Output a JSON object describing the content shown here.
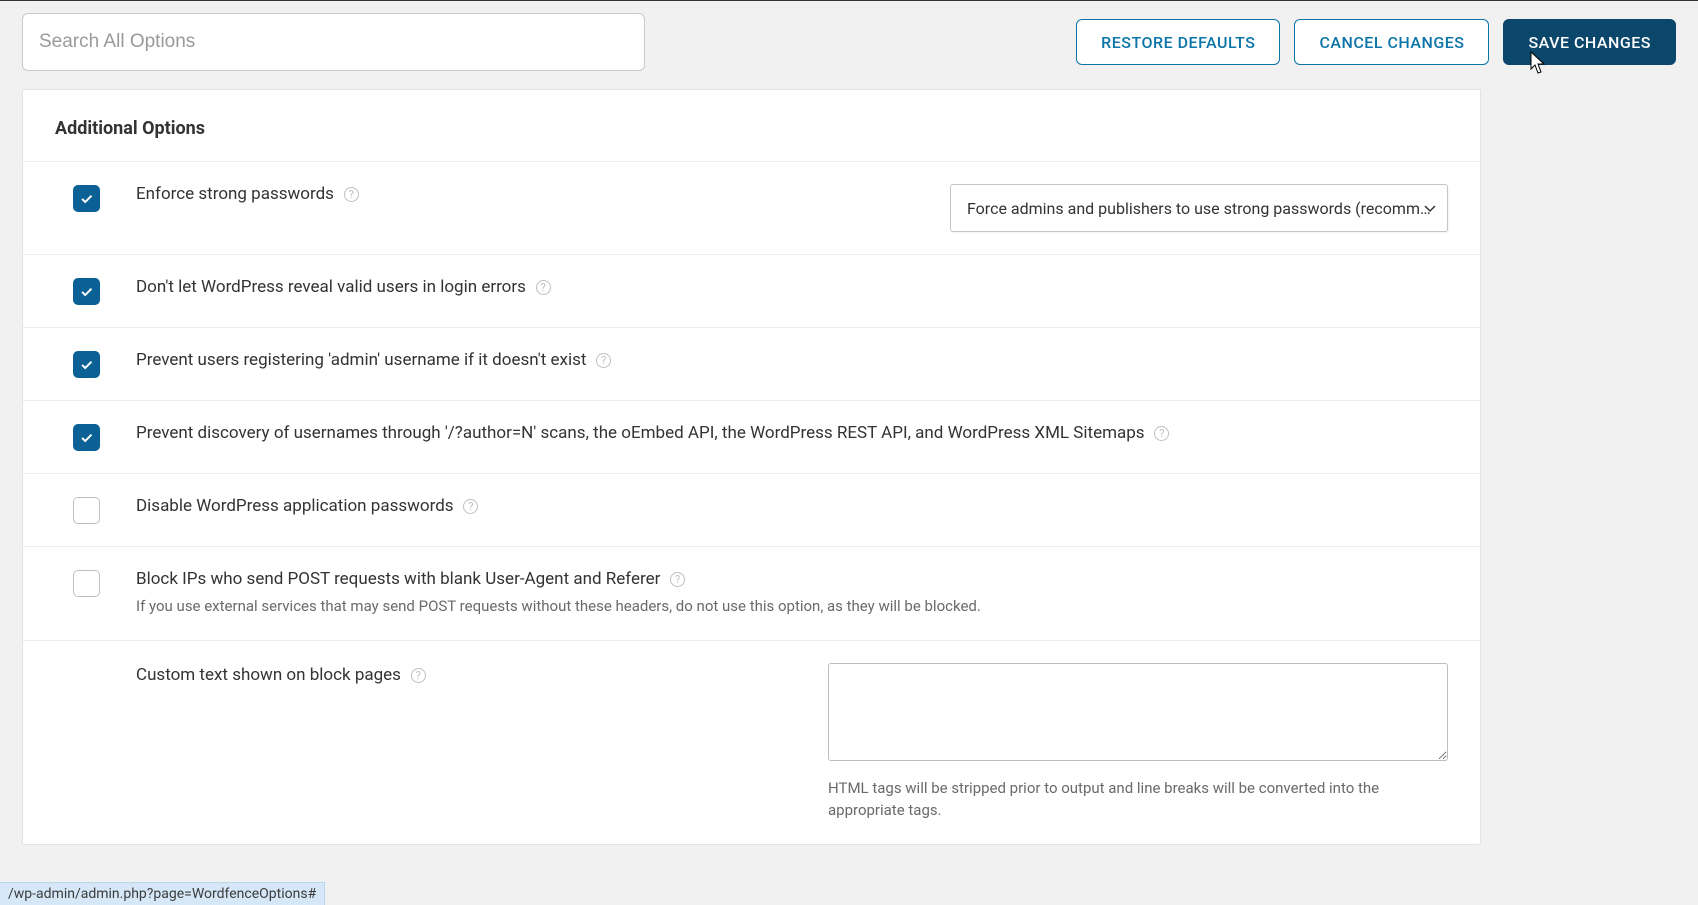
{
  "search": {
    "placeholder": "Search All Options"
  },
  "buttons": {
    "restore_defaults": "RESTORE DEFAULTS",
    "cancel_changes": "CANCEL CHANGES",
    "save_changes": "SAVE CHANGES"
  },
  "section_title": "Additional Options",
  "options": [
    {
      "label": "Enforce strong passwords",
      "checked": true,
      "has_select": true,
      "select_value": "Force admins and publishers to use strong passwords (recomm…"
    },
    {
      "label": "Don't let WordPress reveal valid users in login errors",
      "checked": true
    },
    {
      "label": "Prevent users registering 'admin' username if it doesn't exist",
      "checked": true
    },
    {
      "label": "Prevent discovery of usernames through '/?author=N' scans, the oEmbed API, the WordPress REST API, and WordPress XML Sitemaps",
      "checked": true
    },
    {
      "label": "Disable WordPress application passwords",
      "checked": false
    },
    {
      "label": "Block IPs who send POST requests with blank User-Agent and Referer",
      "checked": false,
      "sub": "If you use external services that may send POST requests without these headers, do not use this option, as they will be blocked."
    }
  ],
  "textarea": {
    "label": "Custom text shown on block pages",
    "help": "HTML tags will be stripped prior to output and line breaks will be converted into the appropriate tags."
  },
  "status_url": "/wp-admin/admin.php?page=WordfenceOptions#"
}
